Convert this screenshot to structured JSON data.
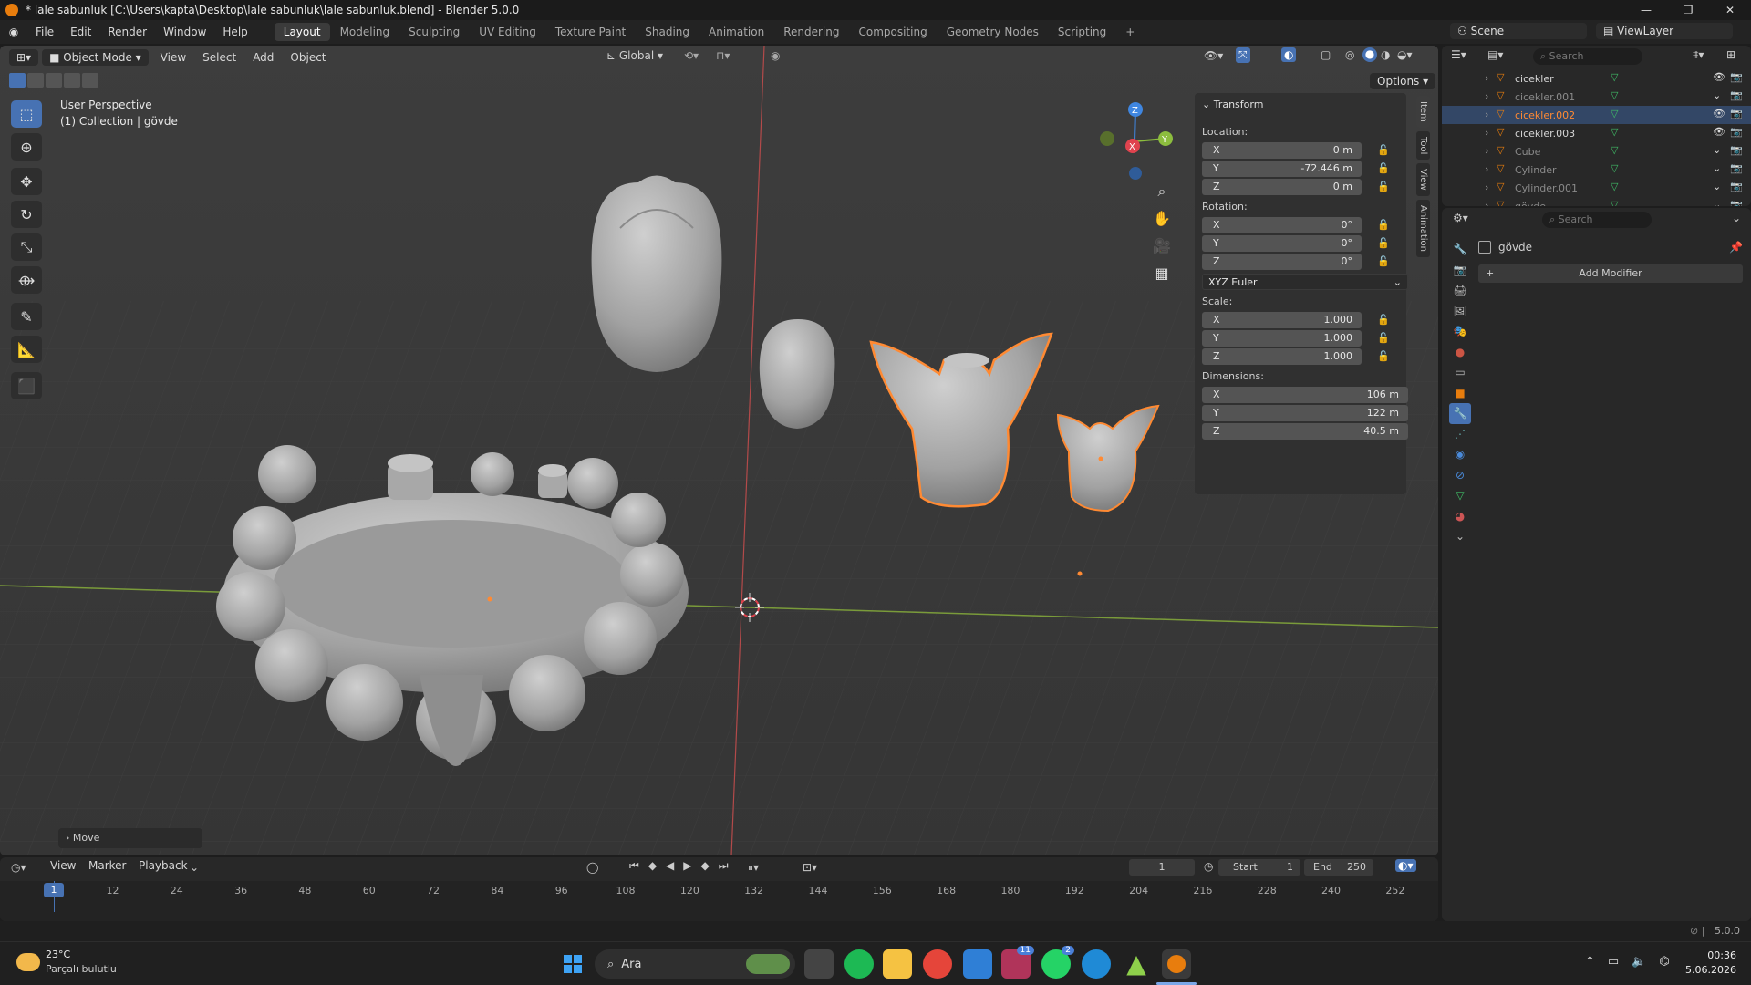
{
  "window": {
    "title": "* lale sabunluk [C:\\Users\\kapta\\Desktop\\lale sabunluk\\lale sabunluk.blend] - Blender 5.0.0",
    "controls": [
      "—",
      "❐",
      "✕"
    ]
  },
  "menu": {
    "items": [
      "File",
      "Edit",
      "Render",
      "Window",
      "Help"
    ],
    "workspaces": [
      "Layout",
      "Modeling",
      "Sculpting",
      "UV Editing",
      "Texture Paint",
      "Shading",
      "Animation",
      "Rendering",
      "Compositing",
      "Geometry Nodes",
      "Scripting"
    ],
    "active_workspace": "Layout",
    "add_tab": "+",
    "scene_label": "Scene",
    "viewlayer_label": "ViewLayer"
  },
  "viewport_header": {
    "mode": "Object Mode",
    "menus": [
      "View",
      "Select",
      "Add",
      "Object"
    ],
    "orientation": "Global",
    "options_label": "Options"
  },
  "viewport": {
    "perspective": "User Perspective",
    "collection": "(1) Collection | gövde",
    "operator_panel": "Move",
    "gizmo_axes": [
      "X",
      "Y",
      "Z"
    ]
  },
  "npanel": {
    "section": "Transform",
    "location_label": "Location:",
    "location": [
      {
        "axis": "X",
        "value": "0 m"
      },
      {
        "axis": "Y",
        "value": "-72.446 m"
      },
      {
        "axis": "Z",
        "value": "0 m"
      }
    ],
    "rotation_label": "Rotation:",
    "rotation": [
      {
        "axis": "X",
        "value": "0°"
      },
      {
        "axis": "Y",
        "value": "0°"
      },
      {
        "axis": "Z",
        "value": "0°"
      }
    ],
    "rotation_mode": "XYZ Euler",
    "scale_label": "Scale:",
    "scale": [
      {
        "axis": "X",
        "value": "1.000"
      },
      {
        "axis": "Y",
        "value": "1.000"
      },
      {
        "axis": "Z",
        "value": "1.000"
      }
    ],
    "dimensions_label": "Dimensions:",
    "dimensions": [
      {
        "axis": "X",
        "value": "106 m"
      },
      {
        "axis": "Y",
        "value": "122 m"
      },
      {
        "axis": "Z",
        "value": "40.5 m"
      }
    ],
    "tabs": [
      "Item",
      "Tool",
      "View",
      "Animation"
    ]
  },
  "outliner": {
    "search_placeholder": "Search",
    "items": [
      {
        "name": "cicekler",
        "selected": false
      },
      {
        "name": "cicekler.001",
        "selected": false
      },
      {
        "name": "cicekler.002",
        "selected": true
      },
      {
        "name": "cicekler.003",
        "selected": false
      },
      {
        "name": "Cube",
        "selected": false
      },
      {
        "name": "Cylinder",
        "selected": false
      },
      {
        "name": "Cylinder.001",
        "selected": false
      },
      {
        "name": "gövde",
        "selected": false
      }
    ]
  },
  "properties": {
    "search_placeholder": "Search",
    "object_name": "gövde",
    "add_modifier": "Add Modifier"
  },
  "timeline": {
    "menus": [
      "View",
      "Marker",
      "Playback"
    ],
    "current_frame": "1",
    "start_label": "Start",
    "start": "1",
    "end_label": "End",
    "end": "250",
    "ticks": [
      "1",
      "12",
      "24",
      "36",
      "48",
      "60",
      "72",
      "84",
      "96",
      "108",
      "120",
      "132",
      "144",
      "156",
      "168",
      "180",
      "192",
      "204",
      "216",
      "228",
      "240",
      "252"
    ]
  },
  "statusbar": {
    "version": "5.0.0"
  },
  "taskbar": {
    "weather_temp": "23°C",
    "weather_desc": "Parçalı bulutlu",
    "search_label": "Ara",
    "time": "00:36",
    "date": "5.06.2026",
    "badge_mail": "11",
    "badge_whatsapp": "2"
  },
  "colors": {
    "accent_blue": "#4772b3",
    "selection_orange": "#ff8a33",
    "axis_red": "#e0434e",
    "axis_green": "#8cbd3e",
    "axis_blue": "#3f86e0"
  }
}
